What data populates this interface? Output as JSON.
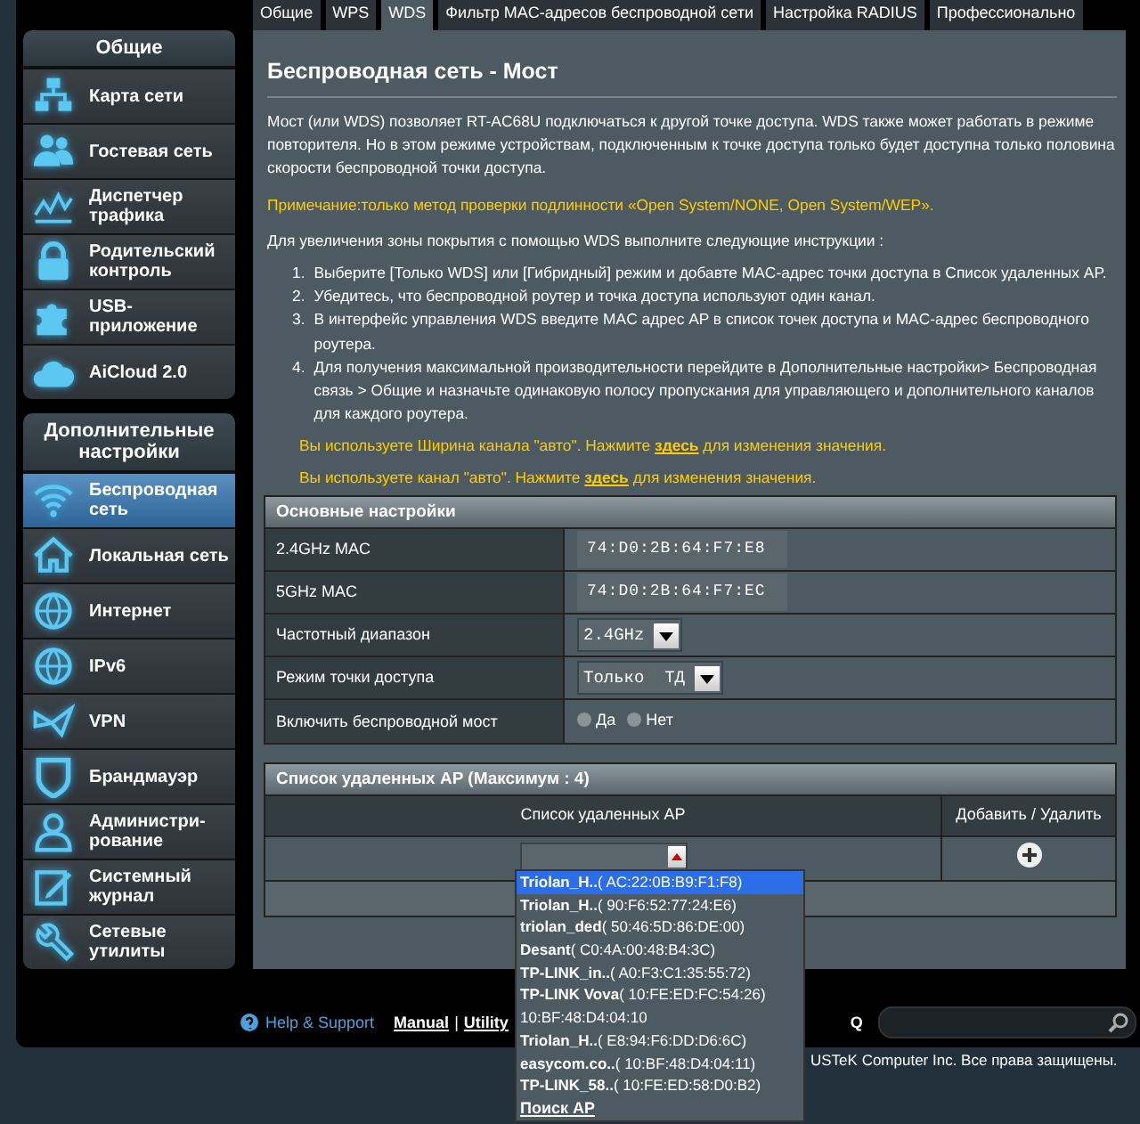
{
  "sidebar": {
    "general_title": "Общие",
    "general_items": [
      {
        "label": "Карта сети",
        "kind": "network",
        "selected": false
      },
      {
        "label": "Гостевая сеть",
        "kind": "people",
        "selected": false
      },
      {
        "label": "Диспетчер трафика",
        "kind": "chart",
        "selected": false
      },
      {
        "label": "Родительский контроль",
        "kind": "lock",
        "selected": false
      },
      {
        "label": "USB-приложение",
        "kind": "puzzle",
        "selected": false
      },
      {
        "label": "AiCloud 2.0",
        "kind": "cloud",
        "selected": false
      }
    ],
    "advanced_title": "Дополнительные настройки",
    "advanced_items": [
      {
        "label": "Беспроводная сеть",
        "kind": "wifi",
        "selected": true
      },
      {
        "label": "Локальная сеть",
        "kind": "house",
        "selected": false
      },
      {
        "label": "Интернет",
        "kind": "globe",
        "selected": false
      },
      {
        "label": "IPv6",
        "kind": "globe",
        "selected": false
      },
      {
        "label": "VPN",
        "kind": "vpn",
        "selected": false
      },
      {
        "label": "Брандмауэр",
        "kind": "shield",
        "selected": false
      },
      {
        "label": "Администри-рование",
        "kind": "person",
        "selected": false
      },
      {
        "label": "Системный журнал",
        "kind": "notepad",
        "selected": false
      },
      {
        "label": "Сетевые утилиты",
        "kind": "wrench",
        "selected": false
      }
    ]
  },
  "tabs": [
    {
      "label": "Общие",
      "selected": false
    },
    {
      "label": "WPS",
      "selected": false
    },
    {
      "label": "WDS",
      "selected": true
    },
    {
      "label": "Фильтр MAC-адресов беспроводной сети",
      "selected": false
    },
    {
      "label": "Настройка RADIUS",
      "selected": false
    },
    {
      "label": "Профессионально",
      "selected": false
    }
  ],
  "page": {
    "title": "Беспроводная сеть - Мост",
    "intro": "Мост (или WDS) позволяет RT-AC68U подключаться к другой точке доступа. WDS также может работать в режиме повторителя. Но в этом режиме устройствам, подключенным к точке доступа только будет доступна только половина скорости беспроводной точки доступа.",
    "note": "Примечание:только метод проверки подлинности «Open System/NONE, Open System/WEP».",
    "instructions_intro": "Для увеличения зоны покрытия с помощью WDS выполните следующие инструкции :",
    "steps": [
      {
        "number": "1.",
        "text": "Выберите [Только WDS] или [Гибридный] режим и добавте MAC-адрес точки доступа в Список удаленных AP."
      },
      {
        "number": "2.",
        "text": "Убедитесь, что беспроводной роутер и точка доступа используют один канал."
      },
      {
        "number": "3.",
        "text": "В интерфейс управления WDS введите MAC адрес AP в список точек доступа и MAC-адрес беспроводного роутера."
      },
      {
        "number": "4.",
        "text": "Для получения максимальной производительности перейдите в Дополнительные настройки> Беспроводная связь > Общие и назначьте одинаковую полосу пропускания для управляющего и дополнительного каналов для каждого роутера."
      }
    ],
    "warnings": [
      {
        "before": "Вы используете Ширина канала \"авто\". Нажмите ",
        "link": "здесь",
        "after": " для изменения значения."
      },
      {
        "before": "Вы используете канал \"авто\". Нажмите ",
        "link": "здесь",
        "after": " для изменения значения."
      }
    ]
  },
  "basic_settings": {
    "title": "Основные настройки",
    "rows": [
      {
        "kind": "text",
        "label": "2.4GHz MAC",
        "value": "74:D0:2B:64:F7:E8"
      },
      {
        "kind": "text",
        "label": "5GHz MAC",
        "value": "74:D0:2B:64:F7:EC"
      },
      {
        "kind": "select",
        "label": "Частотный диапазон",
        "value": "2.4GHz"
      },
      {
        "kind": "select",
        "label": "Режим точки доступа",
        "value": "Только  ТД"
      },
      {
        "kind": "radio",
        "label": "Включить беспроводной мост",
        "options": [
          {
            "label": "Да",
            "selected": false
          },
          {
            "label": "Нет",
            "selected": false
          }
        ]
      }
    ]
  },
  "ap_list": {
    "title": "Список удаленных AP (Максимум : 4)",
    "columns": [
      "Список удаленных AP",
      "Добавить / Удалить"
    ],
    "dropdown": {
      "items": [
        {
          "label": "**Triolan_H..**( AC:22:0B:B9:F1:F8)",
          "selected": true
        },
        {
          "label": "**Triolan_H..**( 90:F6:52:77:24:E6)",
          "selected": false
        },
        {
          "label": "**triolan_ded**( 50:46:5D:86:DE:00)",
          "selected": false
        },
        {
          "label": "**Desant**( C0:4A:00:48:B4:3C)",
          "selected": false
        },
        {
          "label": "**TP-LINK_in..**( A0:F3:C1:35:55:72)",
          "selected": false
        },
        {
          "label": "**TP-LINK Vova**( 10:FE:ED:FC:54:26)",
          "selected": false
        },
        {
          "label": "10:BF:48:D4:04:10",
          "selected": false
        },
        {
          "label": "**Triolan_H..**( E8:94:F6:DD:D6:6C)",
          "selected": false
        },
        {
          "label": "**easycom.co..**( 10:BF:48:D4:04:11)",
          "selected": false
        },
        {
          "label": "**TP-LINK_58..**( 10:FE:ED:58:D0:B2)",
          "selected": false
        }
      ],
      "search_link": "Поиск AP"
    }
  },
  "footer": {
    "help": "Help & Support",
    "links": [
      "Manual",
      "Utility"
    ],
    "separator": "|",
    "faq": "Q",
    "copyright": "USTeK Computer Inc. Все права защищены."
  }
}
